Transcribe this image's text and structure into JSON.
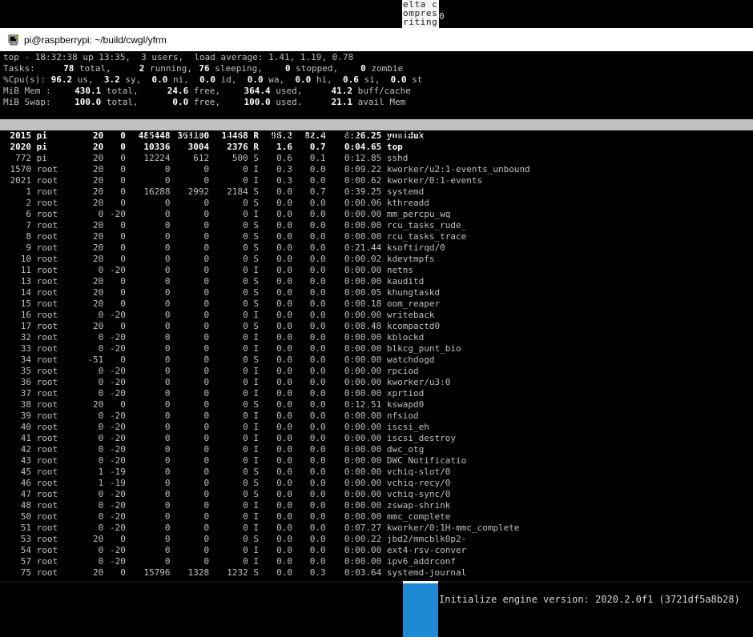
{
  "background": {
    "fragment_lines": [
      "elta c",
      "ompres",
      "riting"
    ],
    "fragment_zero": "0",
    "unity_message": "Initialize engine version: 2020.2.0f1 (3721df5a8b28)"
  },
  "window": {
    "title": "pi@raspberrypi: ~/build/cwgl/yfrm"
  },
  "summary": {
    "line1": "top - 18:32:38 up 13:35,  3 users,  load average: 1.41, 1.19, 0.78",
    "tasks": {
      "label": "Tasks:",
      "total": "78",
      "total_l": "total,",
      "running": "2",
      "running_l": "running,",
      "sleeping": "76",
      "sleeping_l": "sleeping,",
      "stopped": "0",
      "stopped_l": "stopped,",
      "zombie": "0",
      "zombie_l": "zombie"
    },
    "cpu": {
      "label": "%Cpu(s):",
      "us": "96.2",
      "us_l": "us,",
      "sy": "3.2",
      "sy_l": "sy,",
      "ni": "0.0",
      "ni_l": "ni,",
      "id": "0.0",
      "id_l": "id,",
      "wa": "0.0",
      "wa_l": "wa,",
      "hi": "0.0",
      "hi_l": "hi,",
      "si": "0.6",
      "si_l": "si,",
      "st": "0.0",
      "st_l": "st"
    },
    "mem": {
      "label": "MiB Mem :",
      "total": "430.1",
      "total_l": "total,",
      "free": "24.6",
      "free_l": "free,",
      "used": "364.4",
      "used_l": "used,",
      "cache": "41.2",
      "cache_l": "buff/cache"
    },
    "swap": {
      "label": "MiB Swap:",
      "total": "100.0",
      "total_l": "total,",
      "free": "0.0",
      "free_l": "free,",
      "used": "100.0",
      "used_l": "used.",
      "avail": "21.1",
      "avail_l": "avail Mem"
    }
  },
  "table": {
    "headers": [
      "PID",
      "USER",
      "PR",
      "NI",
      "VIRT",
      "RES",
      "SHR",
      "S",
      "%CPU",
      "%MEM",
      "TIME+",
      "COMMAND"
    ],
    "rows": [
      {
        "pid": "2015",
        "user": "pi",
        "pr": "20",
        "ni": "0",
        "virt": "485448",
        "res": "363100",
        "shr": "14468",
        "s": "R",
        "cpu": "96.2",
        "mem": "82.4",
        "time": "8:26.25",
        "cmd": "yuniduk",
        "hot": true
      },
      {
        "pid": "2020",
        "user": "pi",
        "pr": "20",
        "ni": "0",
        "virt": "10336",
        "res": "3004",
        "shr": "2376",
        "s": "R",
        "cpu": "1.6",
        "mem": "0.7",
        "time": "0:04.65",
        "cmd": "top",
        "hot": true
      },
      {
        "pid": "772",
        "user": "pi",
        "pr": "20",
        "ni": "0",
        "virt": "12224",
        "res": "612",
        "shr": "500",
        "s": "S",
        "cpu": "0.6",
        "mem": "0.1",
        "time": "0:12.85",
        "cmd": "sshd"
      },
      {
        "pid": "1570",
        "user": "root",
        "pr": "20",
        "ni": "0",
        "virt": "0",
        "res": "0",
        "shr": "0",
        "s": "I",
        "cpu": "0.3",
        "mem": "0.0",
        "time": "0:09.22",
        "cmd": "kworker/u2:1-events_unbound"
      },
      {
        "pid": "2021",
        "user": "root",
        "pr": "20",
        "ni": "0",
        "virt": "0",
        "res": "0",
        "shr": "0",
        "s": "I",
        "cpu": "0.3",
        "mem": "0.0",
        "time": "0:00.62",
        "cmd": "kworker/0:1-events"
      },
      {
        "pid": "1",
        "user": "root",
        "pr": "20",
        "ni": "0",
        "virt": "16288",
        "res": "2992",
        "shr": "2184",
        "s": "S",
        "cpu": "0.0",
        "mem": "0.7",
        "time": "0:39.25",
        "cmd": "systemd"
      },
      {
        "pid": "2",
        "user": "root",
        "pr": "20",
        "ni": "0",
        "virt": "0",
        "res": "0",
        "shr": "0",
        "s": "S",
        "cpu": "0.0",
        "mem": "0.0",
        "time": "0:00.06",
        "cmd": "kthreadd"
      },
      {
        "pid": "6",
        "user": "root",
        "pr": "0",
        "ni": "-20",
        "virt": "0",
        "res": "0",
        "shr": "0",
        "s": "I",
        "cpu": "0.0",
        "mem": "0.0",
        "time": "0:00.00",
        "cmd": "mm_percpu_wq"
      },
      {
        "pid": "7",
        "user": "root",
        "pr": "20",
        "ni": "0",
        "virt": "0",
        "res": "0",
        "shr": "0",
        "s": "S",
        "cpu": "0.0",
        "mem": "0.0",
        "time": "0:00.00",
        "cmd": "rcu_tasks_rude_"
      },
      {
        "pid": "8",
        "user": "root",
        "pr": "20",
        "ni": "0",
        "virt": "0",
        "res": "0",
        "shr": "0",
        "s": "S",
        "cpu": "0.0",
        "mem": "0.0",
        "time": "0:00.00",
        "cmd": "rcu_tasks_trace"
      },
      {
        "pid": "9",
        "user": "root",
        "pr": "20",
        "ni": "0",
        "virt": "0",
        "res": "0",
        "shr": "0",
        "s": "S",
        "cpu": "0.0",
        "mem": "0.0",
        "time": "0:21.44",
        "cmd": "ksoftirqd/0"
      },
      {
        "pid": "10",
        "user": "root",
        "pr": "20",
        "ni": "0",
        "virt": "0",
        "res": "0",
        "shr": "0",
        "s": "S",
        "cpu": "0.0",
        "mem": "0.0",
        "time": "0:00.02",
        "cmd": "kdevtmpfs"
      },
      {
        "pid": "11",
        "user": "root",
        "pr": "0",
        "ni": "-20",
        "virt": "0",
        "res": "0",
        "shr": "0",
        "s": "I",
        "cpu": "0.0",
        "mem": "0.0",
        "time": "0:00.00",
        "cmd": "netns"
      },
      {
        "pid": "13",
        "user": "root",
        "pr": "20",
        "ni": "0",
        "virt": "0",
        "res": "0",
        "shr": "0",
        "s": "S",
        "cpu": "0.0",
        "mem": "0.0",
        "time": "0:00.00",
        "cmd": "kauditd"
      },
      {
        "pid": "14",
        "user": "root",
        "pr": "20",
        "ni": "0",
        "virt": "0",
        "res": "0",
        "shr": "0",
        "s": "S",
        "cpu": "0.0",
        "mem": "0.0",
        "time": "0:00.05",
        "cmd": "khungtaskd"
      },
      {
        "pid": "15",
        "user": "root",
        "pr": "20",
        "ni": "0",
        "virt": "0",
        "res": "0",
        "shr": "0",
        "s": "S",
        "cpu": "0.0",
        "mem": "0.0",
        "time": "0:00.18",
        "cmd": "oom_reaper"
      },
      {
        "pid": "16",
        "user": "root",
        "pr": "0",
        "ni": "-20",
        "virt": "0",
        "res": "0",
        "shr": "0",
        "s": "I",
        "cpu": "0.0",
        "mem": "0.0",
        "time": "0:00.00",
        "cmd": "writeback"
      },
      {
        "pid": "17",
        "user": "root",
        "pr": "20",
        "ni": "0",
        "virt": "0",
        "res": "0",
        "shr": "0",
        "s": "S",
        "cpu": "0.0",
        "mem": "0.0",
        "time": "0:08.48",
        "cmd": "kcompactd0"
      },
      {
        "pid": "32",
        "user": "root",
        "pr": "0",
        "ni": "-20",
        "virt": "0",
        "res": "0",
        "shr": "0",
        "s": "I",
        "cpu": "0.0",
        "mem": "0.0",
        "time": "0:00.00",
        "cmd": "kblockd"
      },
      {
        "pid": "33",
        "user": "root",
        "pr": "0",
        "ni": "-20",
        "virt": "0",
        "res": "0",
        "shr": "0",
        "s": "I",
        "cpu": "0.0",
        "mem": "0.0",
        "time": "0:00.00",
        "cmd": "blkcg_punt_bio"
      },
      {
        "pid": "34",
        "user": "root",
        "pr": "-51",
        "ni": "0",
        "virt": "0",
        "res": "0",
        "shr": "0",
        "s": "S",
        "cpu": "0.0",
        "mem": "0.0",
        "time": "0:00.00",
        "cmd": "watchdogd"
      },
      {
        "pid": "35",
        "user": "root",
        "pr": "0",
        "ni": "-20",
        "virt": "0",
        "res": "0",
        "shr": "0",
        "s": "I",
        "cpu": "0.0",
        "mem": "0.0",
        "time": "0:00.00",
        "cmd": "rpciod"
      },
      {
        "pid": "36",
        "user": "root",
        "pr": "0",
        "ni": "-20",
        "virt": "0",
        "res": "0",
        "shr": "0",
        "s": "I",
        "cpu": "0.0",
        "mem": "0.0",
        "time": "0:00.00",
        "cmd": "kworker/u3:0"
      },
      {
        "pid": "37",
        "user": "root",
        "pr": "0",
        "ni": "-20",
        "virt": "0",
        "res": "0",
        "shr": "0",
        "s": "I",
        "cpu": "0.0",
        "mem": "0.0",
        "time": "0:00.00",
        "cmd": "xprtiod"
      },
      {
        "pid": "38",
        "user": "root",
        "pr": "20",
        "ni": "0",
        "virt": "0",
        "res": "0",
        "shr": "0",
        "s": "S",
        "cpu": "0.0",
        "mem": "0.0",
        "time": "0:12.51",
        "cmd": "kswapd0"
      },
      {
        "pid": "39",
        "user": "root",
        "pr": "0",
        "ni": "-20",
        "virt": "0",
        "res": "0",
        "shr": "0",
        "s": "I",
        "cpu": "0.0",
        "mem": "0.0",
        "time": "0:00.00",
        "cmd": "nfsiod"
      },
      {
        "pid": "40",
        "user": "root",
        "pr": "0",
        "ni": "-20",
        "virt": "0",
        "res": "0",
        "shr": "0",
        "s": "I",
        "cpu": "0.0",
        "mem": "0.0",
        "time": "0:00.00",
        "cmd": "iscsi_eh"
      },
      {
        "pid": "41",
        "user": "root",
        "pr": "0",
        "ni": "-20",
        "virt": "0",
        "res": "0",
        "shr": "0",
        "s": "I",
        "cpu": "0.0",
        "mem": "0.0",
        "time": "0:00.00",
        "cmd": "iscsi_destroy"
      },
      {
        "pid": "42",
        "user": "root",
        "pr": "0",
        "ni": "-20",
        "virt": "0",
        "res": "0",
        "shr": "0",
        "s": "I",
        "cpu": "0.0",
        "mem": "0.0",
        "time": "0:00.00",
        "cmd": "dwc_otg"
      },
      {
        "pid": "43",
        "user": "root",
        "pr": "0",
        "ni": "-20",
        "virt": "0",
        "res": "0",
        "shr": "0",
        "s": "I",
        "cpu": "0.0",
        "mem": "0.0",
        "time": "0:00.00",
        "cmd": "DWC Notificatio"
      },
      {
        "pid": "45",
        "user": "root",
        "pr": "1",
        "ni": "-19",
        "virt": "0",
        "res": "0",
        "shr": "0",
        "s": "S",
        "cpu": "0.0",
        "mem": "0.0",
        "time": "0:00.00",
        "cmd": "vchiq-slot/0"
      },
      {
        "pid": "46",
        "user": "root",
        "pr": "1",
        "ni": "-19",
        "virt": "0",
        "res": "0",
        "shr": "0",
        "s": "S",
        "cpu": "0.0",
        "mem": "0.0",
        "time": "0:00.00",
        "cmd": "vchiq-recy/0"
      },
      {
        "pid": "47",
        "user": "root",
        "pr": "0",
        "ni": "-20",
        "virt": "0",
        "res": "0",
        "shr": "0",
        "s": "S",
        "cpu": "0.0",
        "mem": "0.0",
        "time": "0:00.00",
        "cmd": "vchiq-sync/0"
      },
      {
        "pid": "48",
        "user": "root",
        "pr": "0",
        "ni": "-20",
        "virt": "0",
        "res": "0",
        "shr": "0",
        "s": "I",
        "cpu": "0.0",
        "mem": "0.0",
        "time": "0:00.00",
        "cmd": "zswap-shrink"
      },
      {
        "pid": "50",
        "user": "root",
        "pr": "0",
        "ni": "-20",
        "virt": "0",
        "res": "0",
        "shr": "0",
        "s": "I",
        "cpu": "0.0",
        "mem": "0.0",
        "time": "0:00.00",
        "cmd": "mmc_complete"
      },
      {
        "pid": "51",
        "user": "root",
        "pr": "0",
        "ni": "-20",
        "virt": "0",
        "res": "0",
        "shr": "0",
        "s": "I",
        "cpu": "0.0",
        "mem": "0.0",
        "time": "0:07.27",
        "cmd": "kworker/0:1H-mmc_complete"
      },
      {
        "pid": "53",
        "user": "root",
        "pr": "20",
        "ni": "0",
        "virt": "0",
        "res": "0",
        "shr": "0",
        "s": "S",
        "cpu": "0.0",
        "mem": "0.0",
        "time": "0:00.22",
        "cmd": "jbd2/mmcblk0p2-"
      },
      {
        "pid": "54",
        "user": "root",
        "pr": "0",
        "ni": "-20",
        "virt": "0",
        "res": "0",
        "shr": "0",
        "s": "I",
        "cpu": "0.0",
        "mem": "0.0",
        "time": "0:00.00",
        "cmd": "ext4-rsv-conver"
      },
      {
        "pid": "57",
        "user": "root",
        "pr": "0",
        "ni": "-20",
        "virt": "0",
        "res": "0",
        "shr": "0",
        "s": "I",
        "cpu": "0.0",
        "mem": "0.0",
        "time": "0:00.00",
        "cmd": "ipv6_addrconf"
      },
      {
        "pid": "75",
        "user": "root",
        "pr": "20",
        "ni": "0",
        "virt": "15796",
        "res": "1328",
        "shr": "1232",
        "s": "S",
        "cpu": "0.0",
        "mem": "0.3",
        "time": "0:03.64",
        "cmd": "systemd-journal"
      }
    ]
  },
  "colors": {
    "terminal_bg": "#000000",
    "text": "#c0c0c0",
    "highlight_text": "#ffffff",
    "header_bar": "#c0c0c0",
    "titlebar": "#ffffff",
    "unity_blue": "#1e8ad6"
  },
  "icons": {
    "titlebar": "putty-terminal-icon"
  }
}
